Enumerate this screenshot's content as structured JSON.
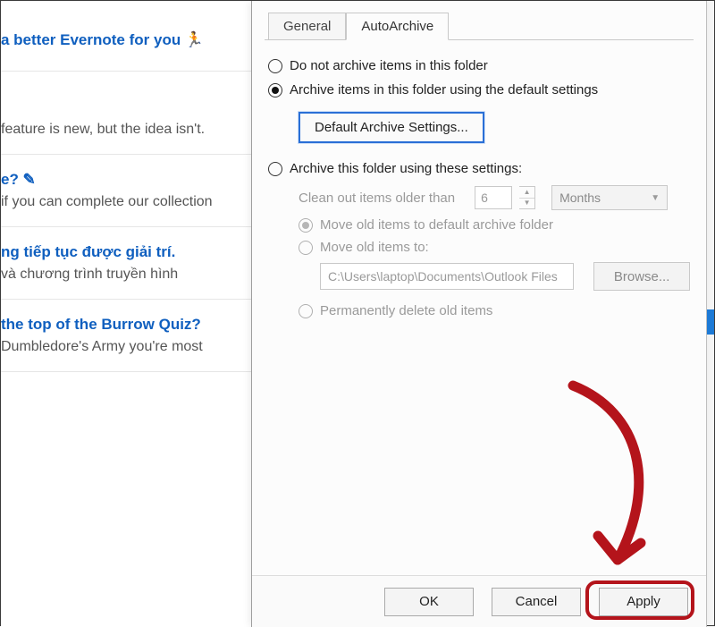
{
  "bg_items": [
    {
      "title": "a better Evernote for you 🏃",
      "sub": ""
    },
    {
      "title": "",
      "sub": "feature is new, but the idea isn't."
    },
    {
      "title": "e? ✎",
      "sub": "if you can complete our collection"
    },
    {
      "title": "ng tiếp tục được giải trí.",
      "sub": "và chương trình truyền hình"
    },
    {
      "title": "the top of the Burrow Quiz?",
      "sub": "Dumbledore's Army you're most"
    }
  ],
  "tabs": {
    "general": "General",
    "autoarchive": "AutoArchive"
  },
  "opts": {
    "do_not": "Do not archive items in this folder",
    "use_default": "Archive items in this folder using the default settings",
    "default_btn": "Default Archive Settings...",
    "custom": "Archive this folder using these settings:"
  },
  "sub": {
    "cleanout_label": "Clean out items older than",
    "cleanout_num": "6",
    "cleanout_unit": "Months",
    "move_default": "Move old items to default archive folder",
    "move_to": "Move old items to:",
    "path": "C:\\Users\\laptop\\Documents\\Outlook Files",
    "browse": "Browse...",
    "perm_delete": "Permanently delete old items"
  },
  "buttons": {
    "ok": "OK",
    "cancel": "Cancel",
    "apply": "Apply"
  }
}
